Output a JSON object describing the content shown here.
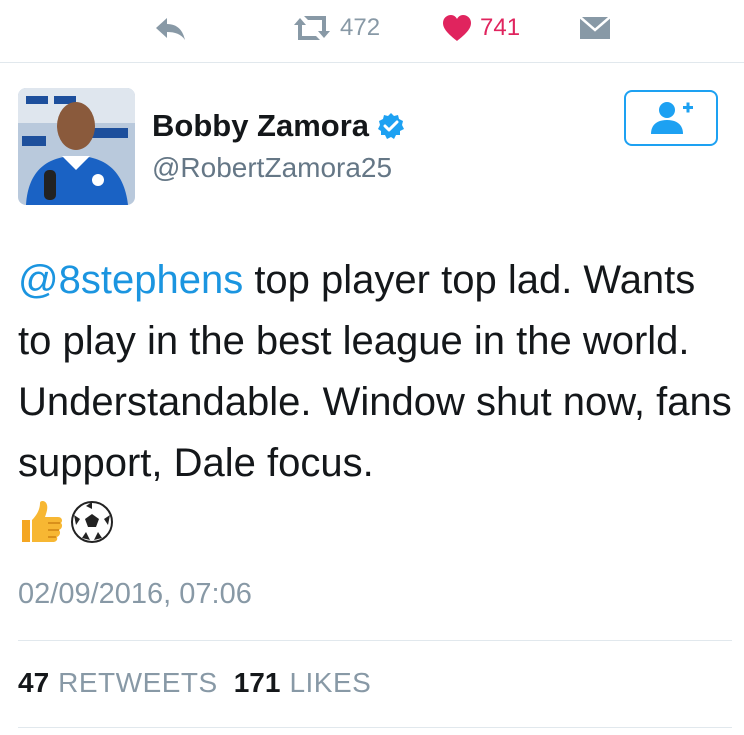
{
  "actions": {
    "reply_icon": "reply-icon",
    "retweet_icon": "retweet-icon",
    "retweet_count": "472",
    "like_icon": "heart-icon",
    "like_count": "741",
    "dm_icon": "direct-message-icon"
  },
  "author": {
    "display_name": "Bobby Zamora",
    "handle": "@RobertZamora25",
    "verified": true
  },
  "tweet": {
    "mention": "@8stephens",
    "text_after_mention": " top player top lad. Wants to play in the best league in the world. Understandable. Window shut now, fans support, Dale focus.",
    "emojis": [
      "thumbs-up-icon",
      "soccer-ball-icon"
    ]
  },
  "timestamp": "02/09/2016, 07:06",
  "stats": {
    "retweets_count": "47",
    "retweets_label": "RETWEETS",
    "likes_count": "171",
    "likes_label": "LIKES"
  },
  "colors": {
    "accent": "#1da1f2",
    "like": "#e0245e",
    "muted": "#8899a6"
  }
}
